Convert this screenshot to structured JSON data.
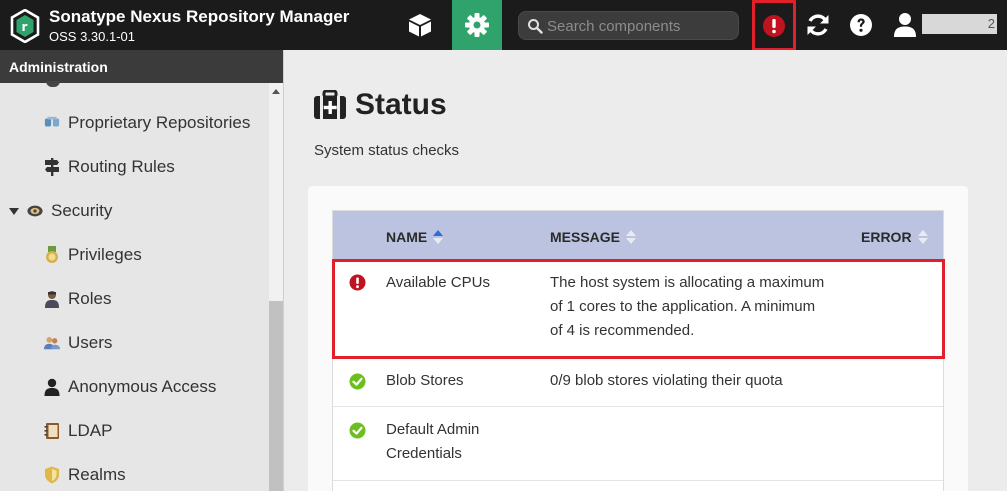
{
  "app": {
    "title": "Sonatype Nexus Repository Manager",
    "version": "OSS 3.30.1-01"
  },
  "header": {
    "search_placeholder": "Search components",
    "username": "2"
  },
  "sidebar": {
    "header": "Administration",
    "items": [
      {
        "label": "Proprietary Repositories",
        "icon": "proprietary-repo-icon"
      },
      {
        "label": "Routing Rules",
        "icon": "signpost-icon"
      },
      {
        "label": "Security",
        "icon": "security-badge-icon"
      },
      {
        "label": "Privileges",
        "icon": "medal-icon"
      },
      {
        "label": "Roles",
        "icon": "role-user-icon"
      },
      {
        "label": "Users",
        "icon": "users-icon"
      },
      {
        "label": "Anonymous Access",
        "icon": "user-icon"
      },
      {
        "label": "LDAP",
        "icon": "address-book-icon"
      },
      {
        "label": "Realms",
        "icon": "shield-icon"
      }
    ]
  },
  "main": {
    "title": "Status",
    "subtitle": "System status checks",
    "columns": {
      "name": "NAME",
      "message": "MESSAGE",
      "error": "ERROR"
    },
    "rows": [
      {
        "status": "error",
        "name": "Available CPUs",
        "message_lines": [
          "The host system is allocating a maximum",
          "of 1 cores to the application. A minimum",
          "of 4 is recommended."
        ]
      },
      {
        "status": "ok",
        "name": "Blob Stores",
        "message_lines": [
          "0/9 blob stores violating their quota"
        ]
      },
      {
        "status": "ok",
        "name_lines": [
          "Default Admin",
          "Credentials"
        ]
      }
    ]
  },
  "colors": {
    "accent_green": "#2fa36b",
    "error_red": "#c1121f",
    "ok_green": "#6cbf1e",
    "header_blue": "#bcc3e0",
    "highlight_red": "#e0202a"
  }
}
